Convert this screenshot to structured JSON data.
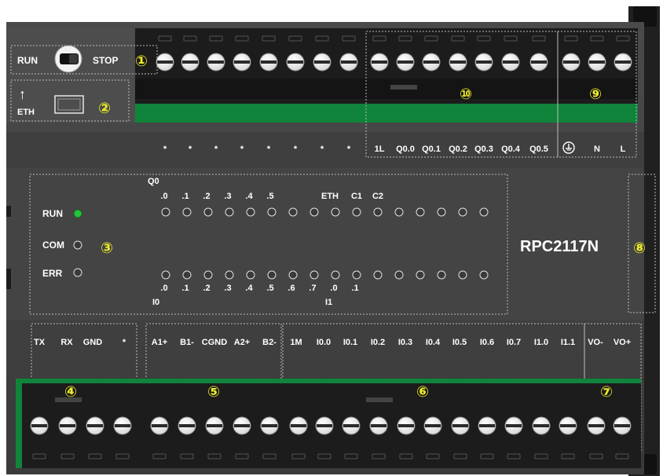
{
  "colors": {
    "body": "#3b3b3b",
    "panel": "#474747",
    "terminal_block": "#1c1c1c",
    "green_strip": "#10843a",
    "badge": "#ecec2a",
    "led_on": "#27c43a",
    "text": "#ffffff"
  },
  "switch": {
    "run": "RUN",
    "stop": "STOP"
  },
  "eth": {
    "arrow": "↑",
    "label": "ETH"
  },
  "badges": [
    "①",
    "②",
    "③",
    "④",
    "⑤",
    "⑥",
    "⑦",
    "⑧",
    "⑨",
    "⑩"
  ],
  "top_terminals": [
    "*",
    "*",
    "*",
    "*",
    "*",
    "*",
    "*",
    "*",
    "1L",
    "Q0.0",
    "Q0.1",
    "Q0.2",
    "Q0.3",
    "Q0.4",
    "Q0.5",
    "ground-icon",
    "N",
    "L"
  ],
  "status_leds": [
    {
      "label": "RUN",
      "on": true
    },
    {
      "label": "COM",
      "on": false
    },
    {
      "label": "ERR",
      "on": false
    }
  ],
  "q0": {
    "group": "Q0",
    "labels": [
      ".0",
      ".1",
      ".2",
      ".3",
      ".4",
      ".5"
    ],
    "extra_labels": [
      "ETH",
      "C1",
      "C2"
    ]
  },
  "i0": {
    "group": "I0",
    "labels": [
      ".0",
      ".1",
      ".2",
      ".3",
      ".4",
      ".5",
      ".6",
      ".7"
    ]
  },
  "i1": {
    "group": "I1",
    "labels": [
      ".0",
      ".1"
    ]
  },
  "model": "RPC2117N",
  "bottom_terminals": [
    "TX",
    "RX",
    "GND",
    "*",
    "A1+",
    "B1-",
    "CGND",
    "A2+",
    "B2-",
    "1M",
    "I0.0",
    "I0.1",
    "I0.2",
    "I0.3",
    "I0.4",
    "I0.5",
    "I0.6",
    "I0.7",
    "I1.0",
    "I1.1",
    "VO-",
    "VO+"
  ]
}
